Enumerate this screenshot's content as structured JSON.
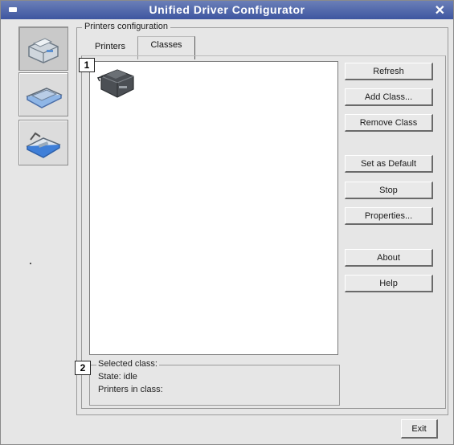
{
  "window": {
    "title": "Unified Driver Configurator",
    "close_glyph": "✕"
  },
  "sidebar": {
    "items": [
      {
        "name": "printers-configuration",
        "icon": "printer-icon",
        "active": true
      },
      {
        "name": "scanners-configuration",
        "icon": "scanner-icon",
        "active": false
      },
      {
        "name": "ports-configuration",
        "icon": "port-icon",
        "active": false
      }
    ]
  },
  "panel": {
    "group_title": "Printers configuration",
    "tabs": [
      {
        "label": "Printers",
        "selected": false
      },
      {
        "label": "Classes",
        "selected": true
      }
    ]
  },
  "callouts": {
    "first": "1",
    "second": "2"
  },
  "class_list": {
    "items": [
      {
        "icon": "printer-class-icon"
      }
    ]
  },
  "buttons": {
    "refresh": "Refresh",
    "add_class": "Add Class...",
    "remove_class": "Remove Class",
    "set_default": "Set as Default",
    "stop": "Stop",
    "properties": "Properties...",
    "about": "About",
    "help": "Help",
    "exit": "Exit"
  },
  "selected_class": {
    "title": "Selected class:",
    "state": "State: idle",
    "printers_in_class": "Printers in class:"
  }
}
